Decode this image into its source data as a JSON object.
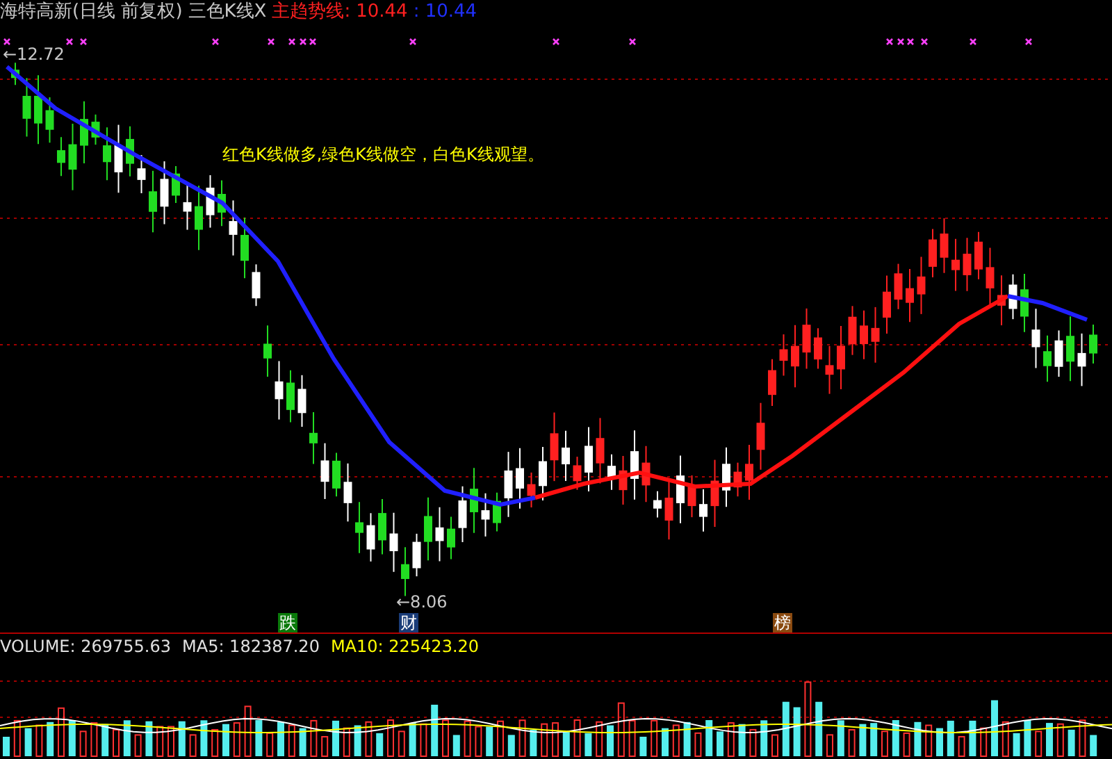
{
  "header": {
    "title": "海特高新(日线 前复权)",
    "indicator": "三色K线X",
    "line_name": "主趋势线:",
    "value_1": "10.44",
    "value_2": ": 10.44"
  },
  "price_labels": [
    {
      "text": "←12.72"
    },
    {
      "text": "←8.06"
    }
  ],
  "note": "红色K线做多,绿色K线做空，白色K线观望。",
  "badges": [
    {
      "text": "跌",
      "color": "#0a7a0a"
    },
    {
      "text": "财",
      "color": "#1a3c78"
    },
    {
      "text": "榜",
      "color": "#8a4a10"
    }
  ],
  "volume_legend": {
    "volume": "VOLUME: 269755.63",
    "ma5": "MA5: 182387.20",
    "ma10": "MA10: 225423.20"
  }
}
